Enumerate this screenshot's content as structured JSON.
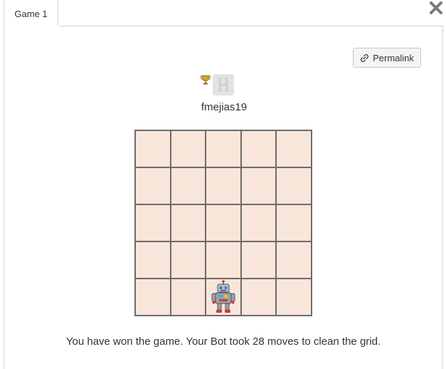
{
  "tabs": [
    {
      "label": "Game 1",
      "active": true
    }
  ],
  "toolbar": {
    "permalink_label": "Permalink",
    "permalink_icon": "link-icon",
    "close_icon": "close-icon"
  },
  "player": {
    "name": "fmejias19",
    "trophy_icon": "trophy-icon",
    "avatar_letter": "H"
  },
  "board": {
    "rows": 5,
    "cols": 5,
    "cell_color": "#f9e6da",
    "line_color": "#6b6b6b",
    "bot_position": {
      "row": 5,
      "col": 3
    },
    "bot_icon": "robot-icon"
  },
  "result": {
    "message": "You have won the game. Your Bot took 28 moves to clean the grid."
  },
  "colors": {
    "accent": "#333333",
    "border": "#d4d4d4"
  }
}
